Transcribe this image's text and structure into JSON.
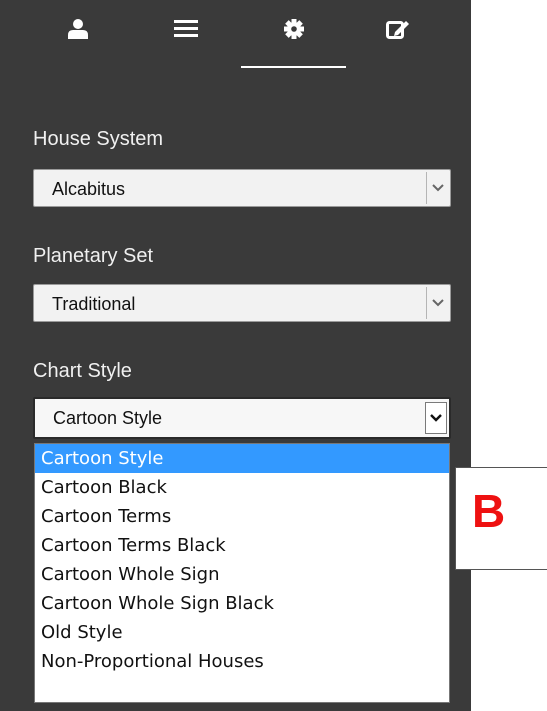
{
  "tabs": [
    {
      "name": "user-icon"
    },
    {
      "name": "menu-icon"
    },
    {
      "name": "settings-icon",
      "active": true
    },
    {
      "name": "edit-icon"
    }
  ],
  "house_system": {
    "label": "House System",
    "value": "Alcabitus"
  },
  "planetary_set": {
    "label": "Planetary Set",
    "value": "Traditional"
  },
  "chart_style": {
    "label": "Chart Style",
    "value": "Cartoon Style",
    "options": [
      "Cartoon Style",
      "Cartoon Black",
      "Cartoon Terms",
      "Cartoon Terms Black",
      "Cartoon Whole Sign",
      "Cartoon Whole Sign Black",
      "Old Style",
      "Non-Proportional Houses"
    ]
  },
  "annotation": {
    "letter": "B",
    "color": "#ee1111"
  },
  "colors": {
    "panel": "#3a3a3a",
    "highlight": "#3399ff"
  }
}
